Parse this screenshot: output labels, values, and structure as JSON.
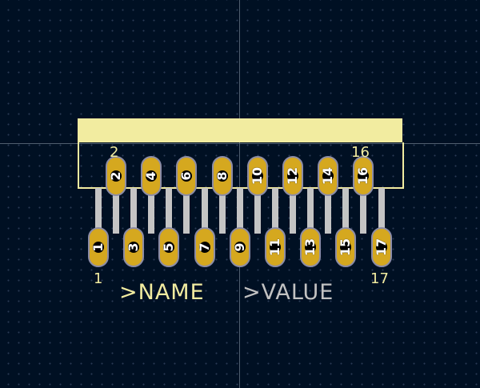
{
  "colors": {
    "background": "#001023",
    "silkscreen": "#f2eca0",
    "fab_value": "#c2c2c2",
    "pad": "#d5a81f",
    "pad_outline": "#8c8ca6",
    "pin_body": "#c4c4c4",
    "crosshair": "#6b7a8a"
  },
  "pins": {
    "top_row": [
      "2",
      "4",
      "6",
      "8",
      "10",
      "12",
      "14",
      "16"
    ],
    "bottom_row": [
      "1",
      "3",
      "5",
      "7",
      "9",
      "11",
      "13",
      "15",
      "17"
    ]
  },
  "silkscreen_labels": {
    "top_left": "2",
    "top_right": "16",
    "bottom_left": "1",
    "bottom_right": "17"
  },
  "fields": {
    "reference": ">NAME",
    "value": ">VALUE"
  }
}
